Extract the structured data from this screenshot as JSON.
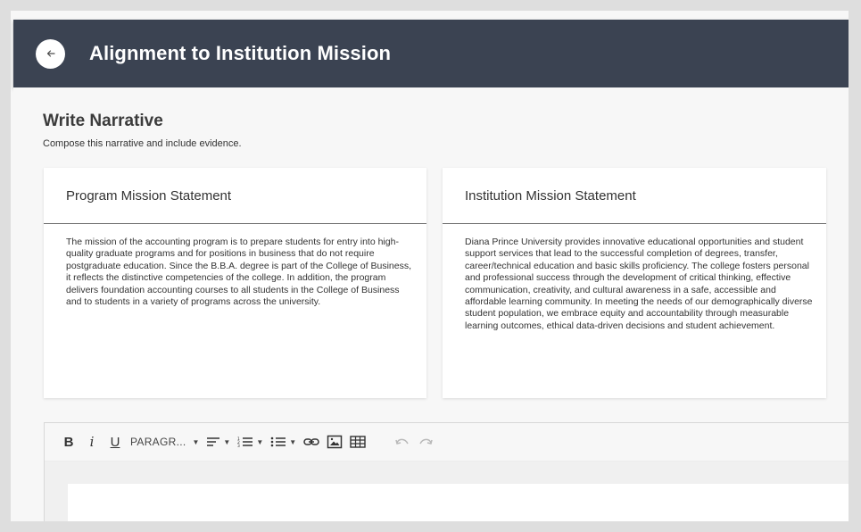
{
  "header": {
    "title": "Alignment to Institution Mission",
    "back_icon": "arrow-left-icon"
  },
  "section": {
    "title": "Write Narrative",
    "subtitle": "Compose this narrative and include evidence."
  },
  "cards": {
    "program": {
      "title": "Program Mission Statement",
      "body": "The mission of the accounting program is to prepare students for entry into high-quality graduate programs and for positions in business that do not require postgraduate education. Since the B.B.A. degree is part of the College of Business, it reflects the distinctive competencies of the college. In addition, the program delivers foundation accounting courses to all students in the College of Business and to students in a variety of programs across the university."
    },
    "institution": {
      "title": "Institution Mission Statement",
      "body": "Diana Prince University provides innovative educational opportunities and student support services that lead to the successful completion of degrees, transfer, career/technical education and basic skills proficiency. The college fosters personal and professional success through the development of critical thinking, effective communication, creativity, and cultural awareness in a safe, accessible and affordable learning community. In meeting the needs of our demographically diverse student population, we embrace equity and accountability through measurable learning outcomes, ethical data-driven decisions and student achievement."
    }
  },
  "toolbar": {
    "bold": "B",
    "italic": "i",
    "underline": "U",
    "paragraph": "PARAGR...",
    "caret": "▼"
  },
  "colors": {
    "header_bg": "#3b4352",
    "page_bg": "#f7f7f7",
    "card_bg": "#ffffff"
  }
}
